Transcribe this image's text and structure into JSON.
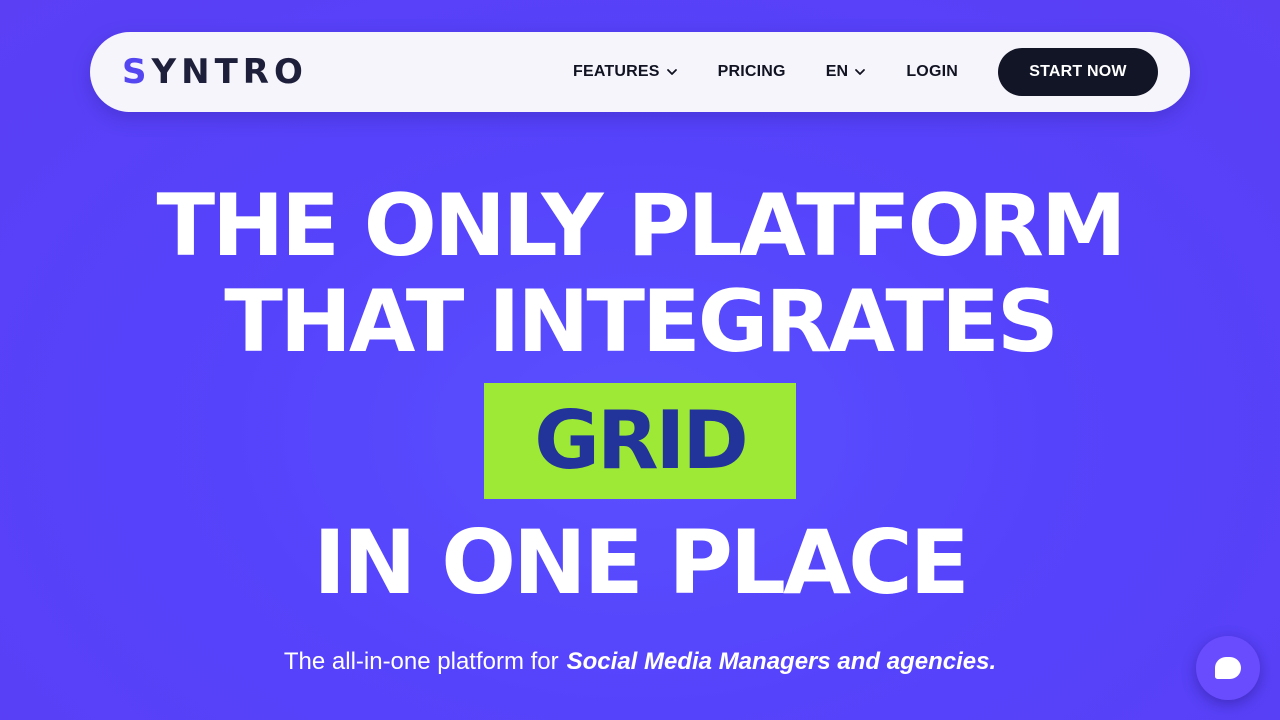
{
  "brand": {
    "logo_first": "S",
    "logo_rest": "YNTRO"
  },
  "nav": {
    "features": "FEATURES",
    "pricing": "PRICING",
    "language": "EN",
    "login": "LOGIN",
    "cta": "START NOW"
  },
  "hero": {
    "line1": "THE ONLY PLATFORM",
    "line2": "THAT INTEGRATES",
    "rotating_word": "GRID",
    "line3": "IN ONE PLACE"
  },
  "subtitle": {
    "lead": "The all-in-one platform for",
    "emphasis": "Social Media Managers and agencies."
  },
  "icons": {
    "chevron": "chevron-down-icon",
    "chat": "chat-bubble-icon"
  },
  "colors": {
    "background": "#5543fb",
    "accent": "#9ee836",
    "accent_text": "#22349a",
    "cta_bg": "#121526"
  }
}
